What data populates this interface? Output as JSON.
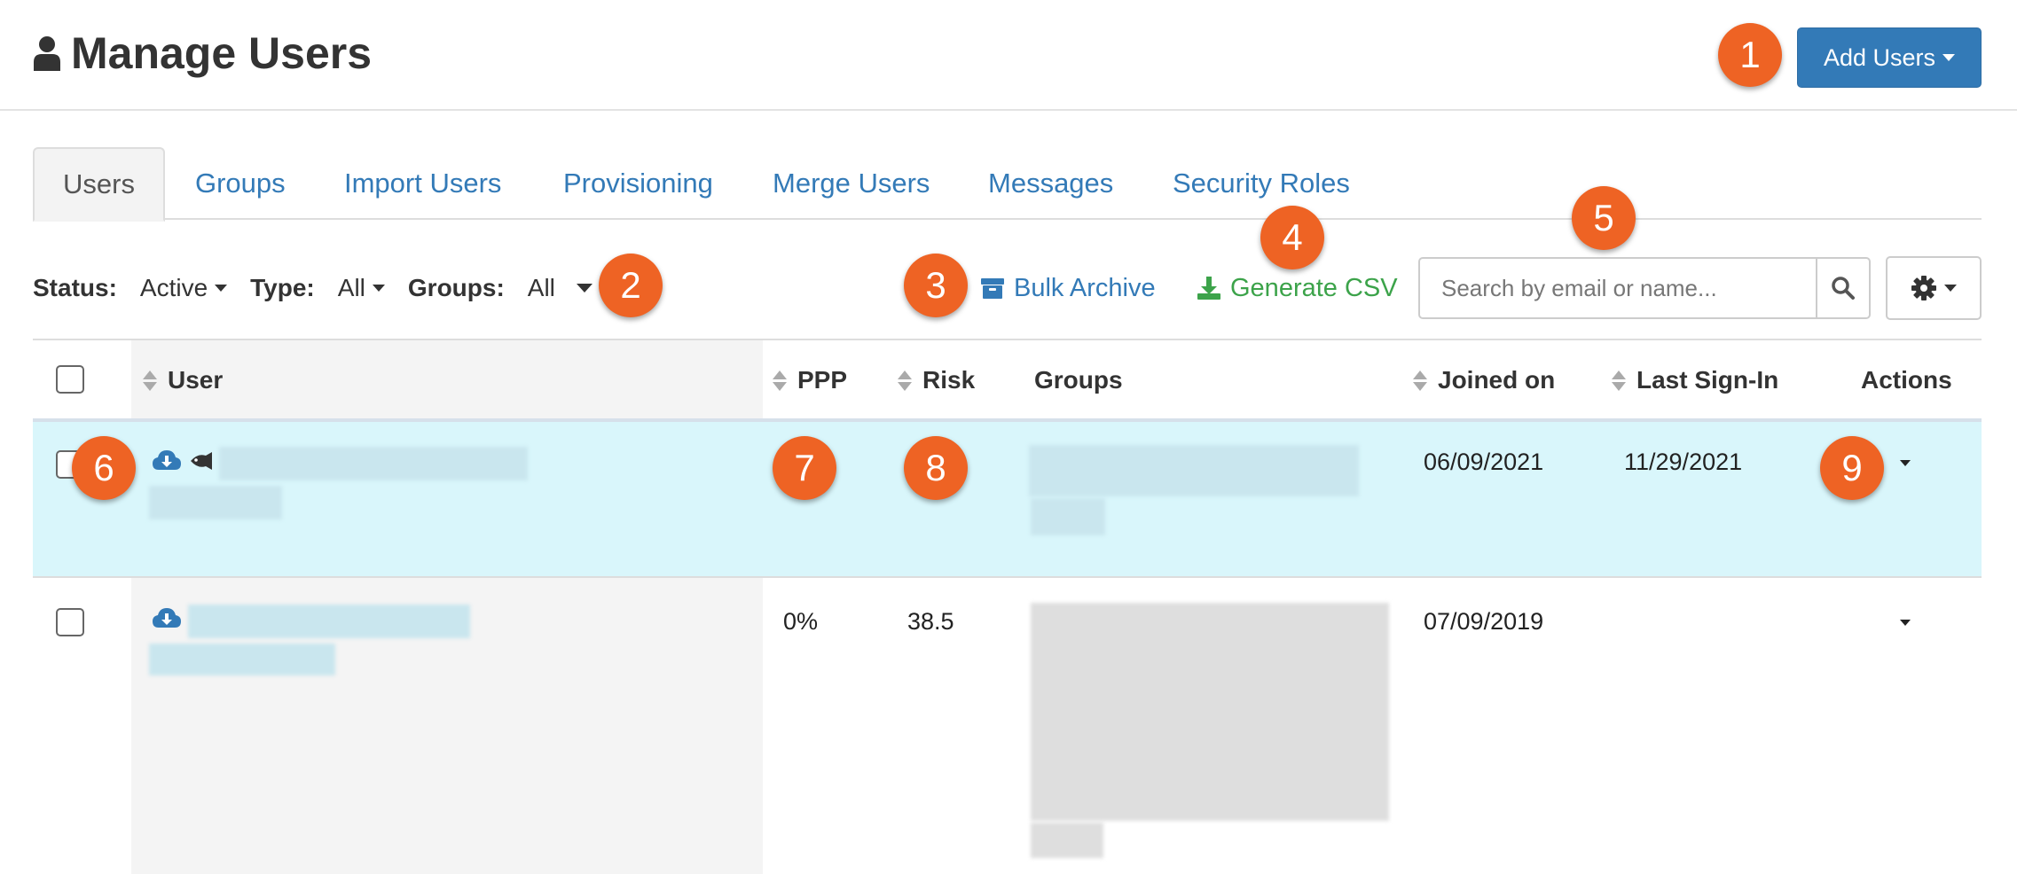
{
  "header": {
    "title": "Manage Users",
    "add_users_label": "Add Users"
  },
  "tabs": [
    {
      "label": "Users",
      "active": true
    },
    {
      "label": "Groups"
    },
    {
      "label": "Import Users"
    },
    {
      "label": "Provisioning"
    },
    {
      "label": "Merge Users"
    },
    {
      "label": "Messages"
    },
    {
      "label": "Security Roles"
    }
  ],
  "filters": {
    "status_label": "Status:",
    "status_value": "Active",
    "type_label": "Type:",
    "type_value": "All",
    "groups_label": "Groups:",
    "groups_value": "All"
  },
  "actions": {
    "bulk_archive": "Bulk Archive",
    "generate_csv": "Generate CSV"
  },
  "search": {
    "placeholder": "Search by email or name...",
    "value": ""
  },
  "table": {
    "columns": [
      "User",
      "PPP",
      "Risk",
      "Groups",
      "Joined on",
      "Last Sign-In",
      "Actions"
    ],
    "rows": [
      {
        "ppp": "",
        "risk": "",
        "joined_on": "06/09/2021",
        "last_sign_in": "11/29/2021",
        "highlighted": true
      },
      {
        "ppp": "0%",
        "risk": "38.5",
        "joined_on": "07/09/2019",
        "last_sign_in": "",
        "highlighted": false
      }
    ]
  },
  "badges": [
    "1",
    "2",
    "3",
    "4",
    "5",
    "6",
    "7",
    "8",
    "9"
  ],
  "colors": {
    "primary": "#337ab7",
    "success": "#3ca34a",
    "badge": "#ee6324",
    "highlight_row": "#d9f6fb"
  },
  "icons": {
    "title": "user-icon",
    "bulk_archive": "archive-box-icon",
    "generate_csv": "download-icon",
    "search": "search-icon",
    "settings": "gear-icon",
    "row_sync": "cloud-download-icon",
    "row_phish": "fish-icon"
  }
}
